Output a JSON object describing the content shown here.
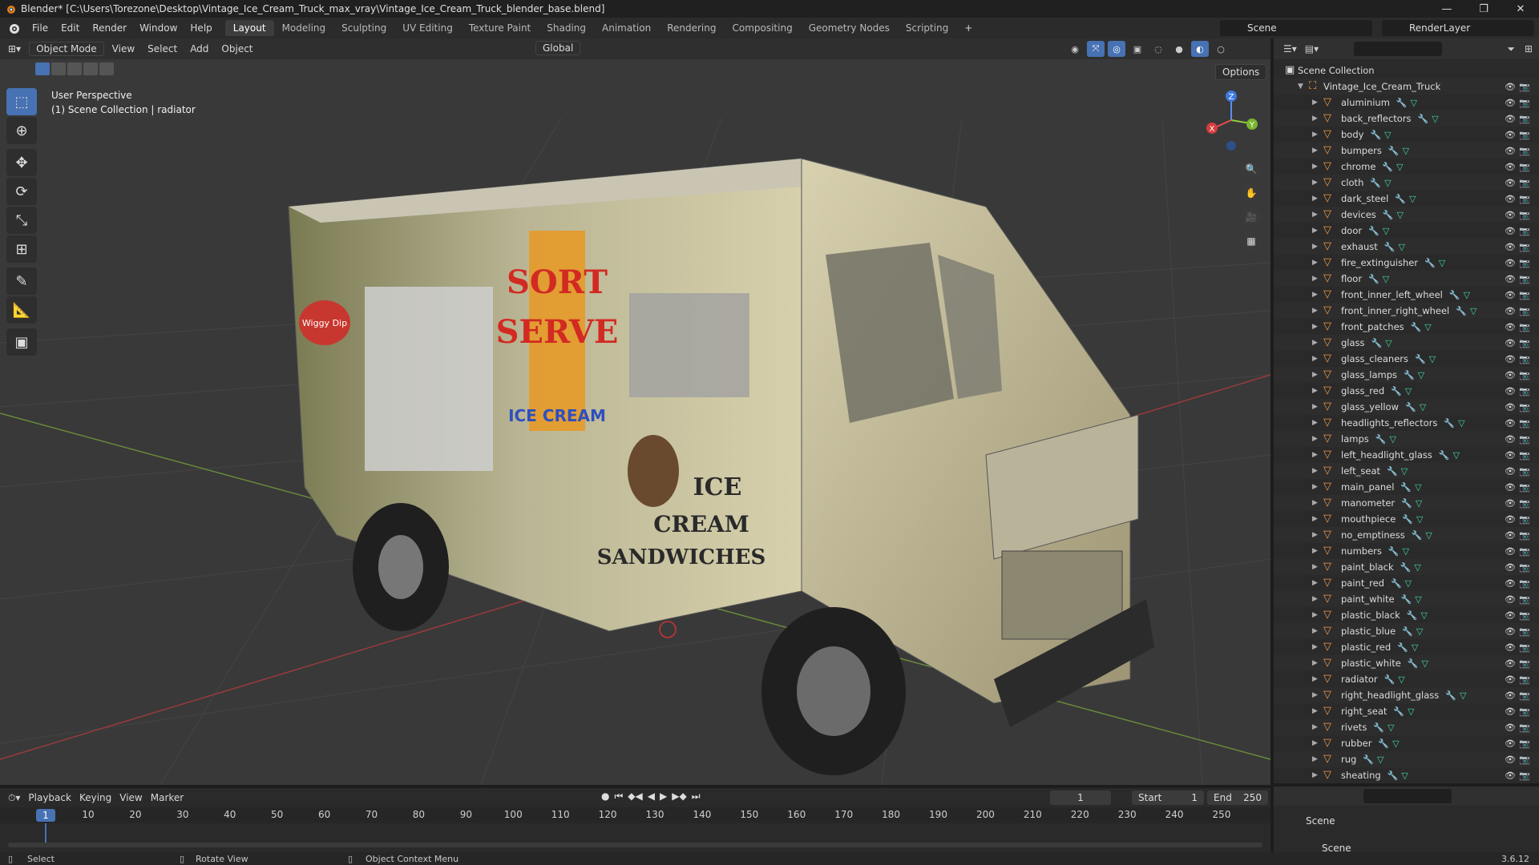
{
  "titlebar": {
    "title": "Blender* [C:\\Users\\Torezone\\Desktop\\Vintage_Ice_Cream_Truck_max_vray\\Vintage_Ice_Cream_Truck_blender_base.blend]",
    "minimize": "—",
    "maximize": "❐",
    "close": "✕"
  },
  "menu": [
    "File",
    "Edit",
    "Render",
    "Window",
    "Help"
  ],
  "workspaces": [
    "Layout",
    "Modeling",
    "Sculpting",
    "UV Editing",
    "Texture Paint",
    "Shading",
    "Animation",
    "Rendering",
    "Compositing",
    "Geometry Nodes",
    "Scripting"
  ],
  "workspace_add": "+",
  "scene_name": "Scene",
  "view_layer": "RenderLayer",
  "viewport": {
    "mode": "Object Mode",
    "menus": [
      "View",
      "Select",
      "Add",
      "Object"
    ],
    "orientation": "Global",
    "options": "Options",
    "overlay_line1": "User Perspective",
    "overlay_line2": "(1) Scene Collection | radiator",
    "truck_text": {
      "logo": "Wiggy Dip",
      "sign1": "SORT",
      "sign2": "SERVE",
      "sign3": "ICE CREAM",
      "side1": "ICE",
      "side2": "CREAM",
      "side3": "SANDWICHES"
    },
    "gizmo": {
      "z": "Z",
      "y": "Y",
      "x": "X"
    }
  },
  "outliner": {
    "root": "Scene Collection",
    "collection": "Vintage_Ice_Cream_Truck",
    "objects": [
      "aluminium",
      "back_reflectors",
      "body",
      "bumpers",
      "chrome",
      "cloth",
      "dark_steel",
      "devices",
      "door",
      "exhaust",
      "fire_extinguisher",
      "floor",
      "front_inner_left_wheel",
      "front_inner_right_wheel",
      "front_patches",
      "glass",
      "glass_cleaners",
      "glass_lamps",
      "glass_red",
      "glass_yellow",
      "headlights_reflectors",
      "lamps",
      "left_headlight_glass",
      "left_seat",
      "main_panel",
      "manometer",
      "mouthpiece",
      "no_emptiness",
      "numbers",
      "paint_black",
      "paint_red",
      "paint_white",
      "plastic_black",
      "plastic_blue",
      "plastic_red",
      "plastic_white",
      "radiator",
      "right_headlight_glass",
      "right_seat",
      "rivets",
      "rubber",
      "rug",
      "sheating"
    ]
  },
  "properties": {
    "scene_label": "Scene",
    "panel_label": "Scene"
  },
  "timeline": {
    "menus": [
      "Playback",
      "Keying",
      "View",
      "Marker"
    ],
    "current_frame": "1",
    "start_label": "Start",
    "start_value": "1",
    "end_label": "End",
    "end_value": "250",
    "ticks": [
      "1",
      "10",
      "20",
      "30",
      "40",
      "50",
      "60",
      "70",
      "80",
      "90",
      "100",
      "110",
      "120",
      "130",
      "140",
      "150",
      "160",
      "170",
      "180",
      "190",
      "200",
      "210",
      "220",
      "230",
      "240",
      "250"
    ]
  },
  "statusbar": {
    "select": "Select",
    "rotate": "Rotate View",
    "context": "Object Context Menu",
    "version": "3.6.12"
  },
  "colors": {
    "accent": "#4772b3",
    "object_icon": "#f29b42",
    "mesh_icon": "#42d6a4"
  }
}
